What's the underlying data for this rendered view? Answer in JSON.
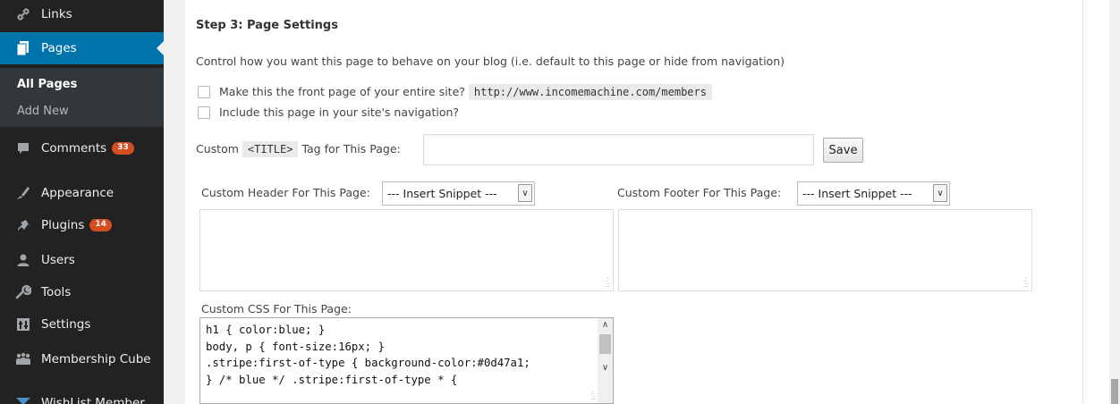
{
  "sidebar": {
    "items": [
      {
        "label": "Links",
        "icon": "link-icon"
      },
      {
        "label": "Pages",
        "icon": "pages-icon"
      },
      {
        "label": "Comments",
        "icon": "comments-icon",
        "badge": "33"
      },
      {
        "label": "Appearance",
        "icon": "appearance-icon"
      },
      {
        "label": "Plugins",
        "icon": "plugins-icon",
        "badge": "14"
      },
      {
        "label": "Users",
        "icon": "users-icon"
      },
      {
        "label": "Tools",
        "icon": "tools-icon"
      },
      {
        "label": "Settings",
        "icon": "settings-icon"
      },
      {
        "label": "Membership Cube",
        "icon": "membership-cube-icon"
      },
      {
        "label": "WishList Member",
        "icon": "wishlist-member-icon"
      }
    ],
    "pages_submenu": [
      "All Pages",
      "Add New"
    ],
    "accent_color": "#0073aa",
    "badge_color": "#d54e21"
  },
  "step": {
    "title": "Step 3: Page Settings",
    "description": "Control how you want this page to behave on your blog (i.e. default to this page or hide from navigation)"
  },
  "options": {
    "front_page_label": "Make this the front page of your entire site?",
    "front_page_url": "http://www.incomemachine.com/members",
    "front_page_checked": false,
    "nav_label": "Include this page in your site's navigation?",
    "nav_checked": false
  },
  "title_tag": {
    "label_prefix": "Custom",
    "tag": "<TITLE>",
    "label_suffix": "Tag for This Page:",
    "value": "",
    "save_label": "Save"
  },
  "header": {
    "label": "Custom Header For This Page:",
    "snippet_select": "--- Insert Snippet ---",
    "content": ""
  },
  "footer": {
    "label": "Custom Footer For This Page:",
    "snippet_select": "--- Insert Snippet ---",
    "content": ""
  },
  "css": {
    "label": "Custom CSS For This Page:",
    "content": "h1 { color:blue; }\nbody, p { font-size:16px; }\n.stripe:first-of-type { background-color:#0d47a1;\n} /* blue */ .stripe:first-of-type * {"
  }
}
